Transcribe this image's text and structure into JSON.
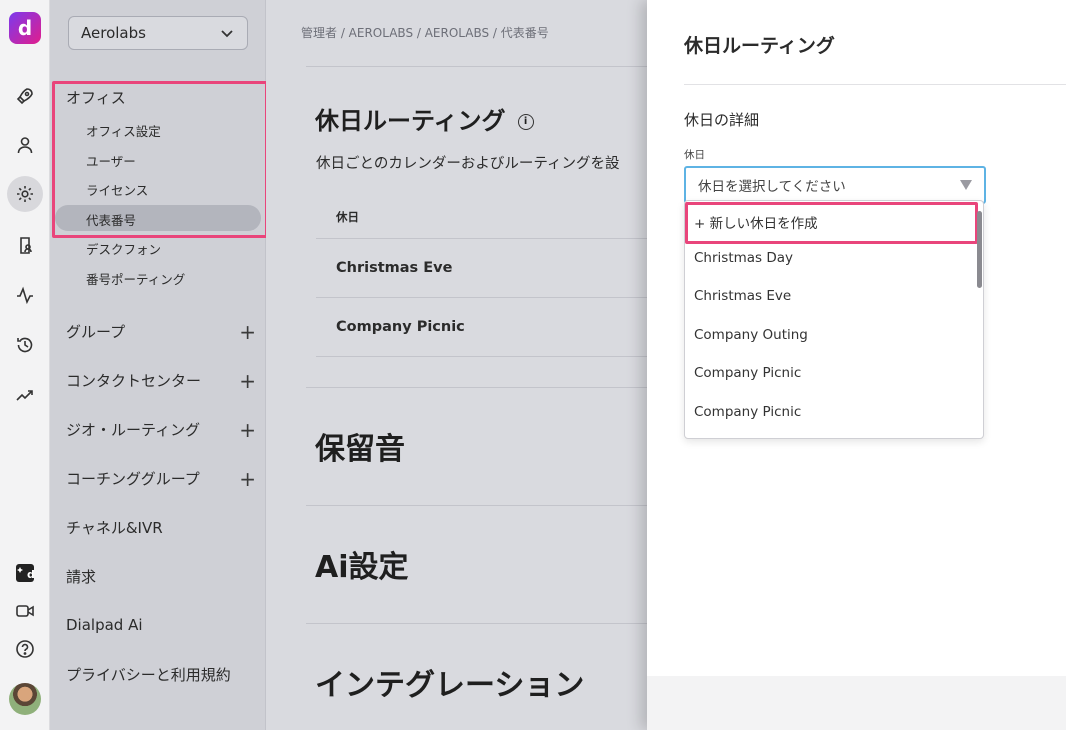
{
  "rail": {
    "logo_letter": "d",
    "icons": [
      "rocket-icon",
      "person-icon",
      "gear-icon",
      "clipboard-person-icon",
      "activity-icon",
      "history-icon",
      "trend-icon",
      "dialpad-ai-icon",
      "video-icon",
      "help-icon"
    ]
  },
  "sidebar": {
    "org_name": "Aerolabs",
    "office_label": "オフィス",
    "office_items": [
      "オフィス設定",
      "ユーザー",
      "ライセンス",
      "代表番号",
      "デスクフォン",
      "番号ポーティング"
    ],
    "active_item": "代表番号",
    "groups": [
      {
        "label": "グループ",
        "expandable": true
      },
      {
        "label": "コンタクトセンター",
        "expandable": true
      },
      {
        "label": "ジオ・ルーティング",
        "expandable": true
      },
      {
        "label": "コーチンググループ",
        "expandable": true
      },
      {
        "label": "チャネル&IVR",
        "expandable": false
      },
      {
        "label": "請求",
        "expandable": false
      },
      {
        "label": "Dialpad Ai",
        "expandable": false
      },
      {
        "label": "プライバシーと利用規約",
        "expandable": false
      }
    ]
  },
  "main": {
    "breadcrumb": "管理者 / AEROLABS / AEROLABS / 代表番号",
    "holiday_title": "休日ルーティング",
    "holiday_desc": "休日ごとのカレンダーおよびルーティングを設",
    "table_header": "休日",
    "rows": [
      "Christmas Eve",
      "Company Picnic"
    ],
    "hold_music_title": "保留音",
    "ai_title": "Ai設定",
    "integration_title": "インテグレーション"
  },
  "drawer": {
    "title": "休日ルーティング",
    "section_title": "休日の詳細",
    "field_label": "休日",
    "select_placeholder": "休日を選択してください",
    "options": [
      "+ 新しい休日を作成",
      "Christmas Day",
      "Christmas Eve",
      "Company Outing",
      "Company Picnic",
      "Company Picnic"
    ]
  },
  "colors": {
    "highlight": "#e9457b",
    "focus": "#5eb3e4",
    "brand_gradient_start": "#7c3aed",
    "brand_gradient_end": "#e11d8c"
  }
}
